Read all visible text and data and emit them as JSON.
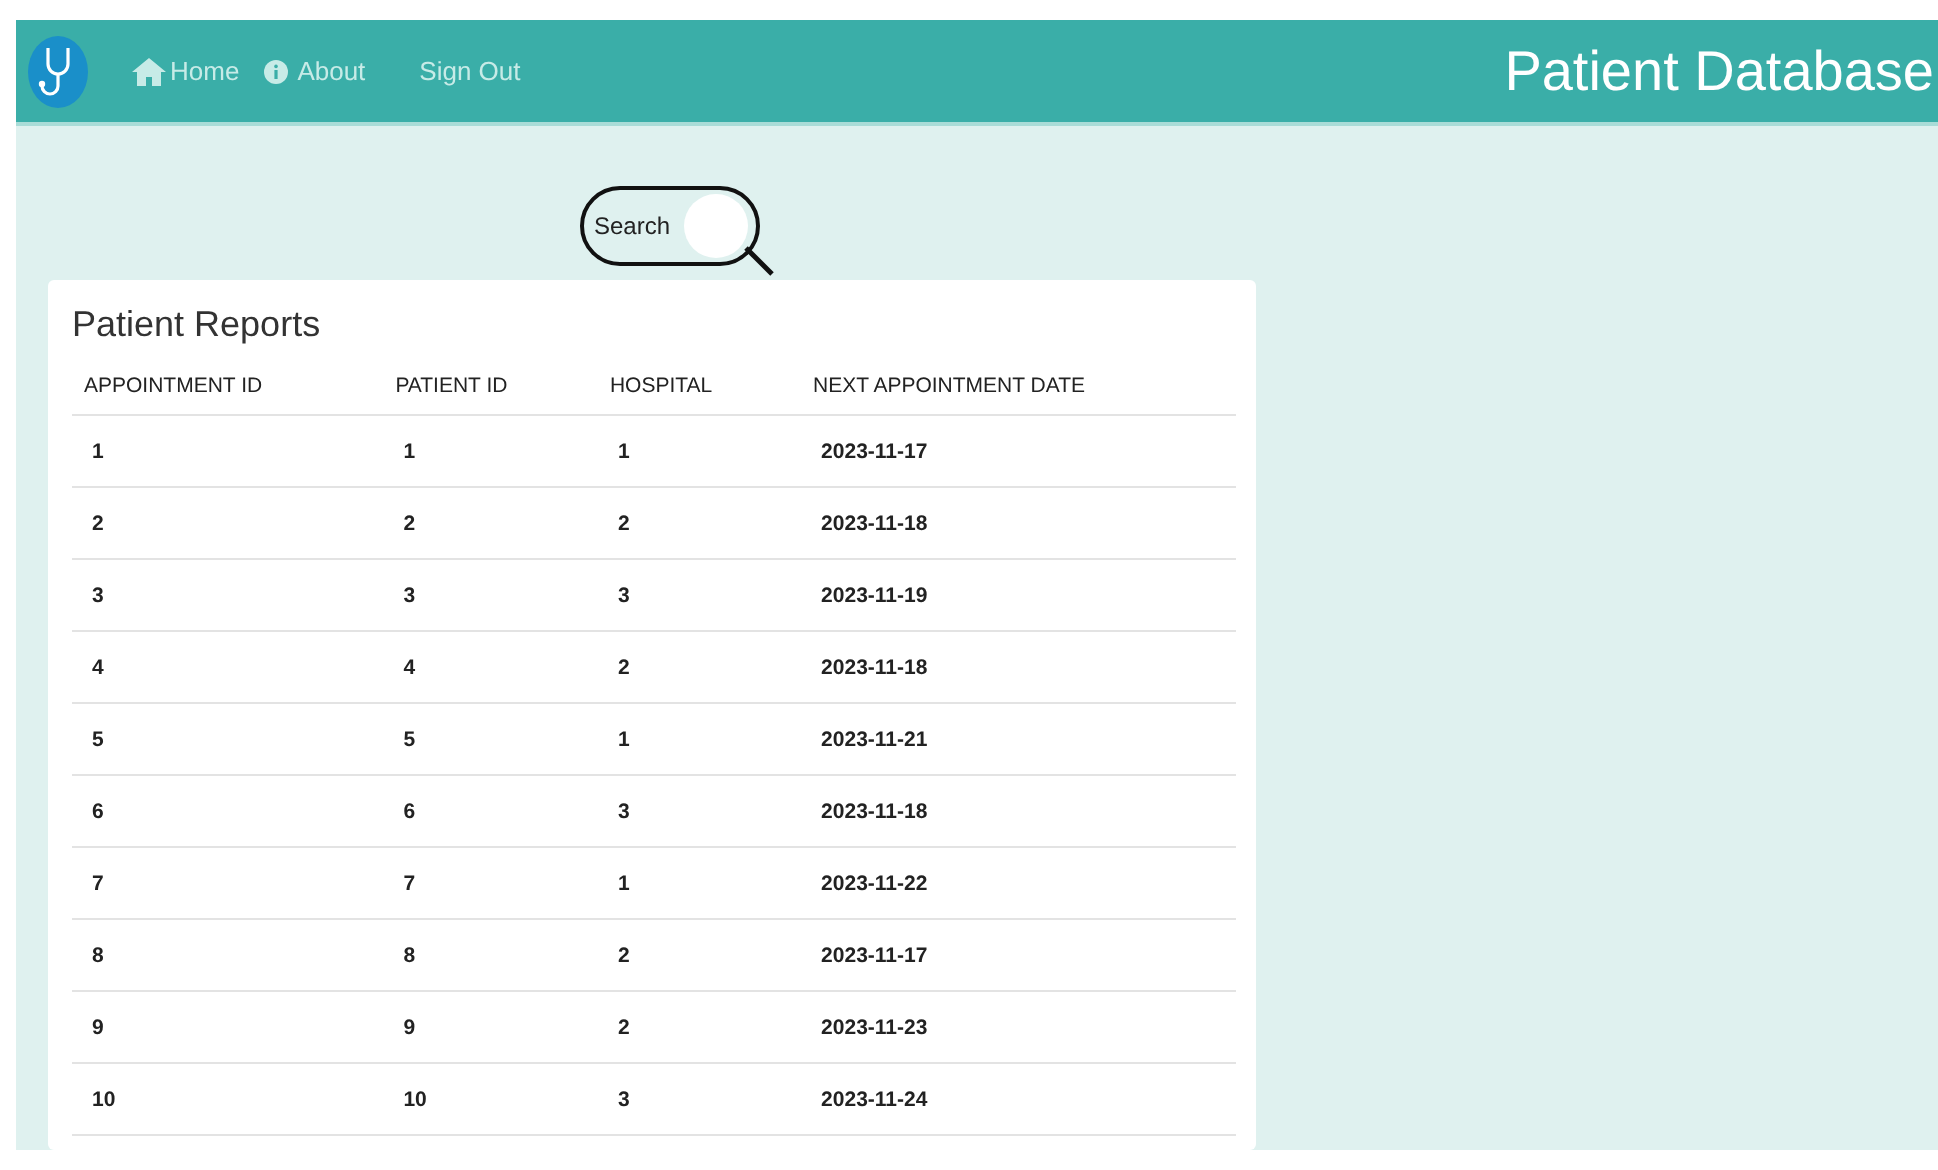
{
  "nav": {
    "links": [
      {
        "label": "Home",
        "kind": "home"
      },
      {
        "label": "About",
        "kind": "info"
      },
      {
        "label": "Sign Out",
        "kind": "plain"
      }
    ],
    "title": "Patient Database"
  },
  "search": {
    "placeholder": "Search"
  },
  "reports": {
    "title": "Patient Reports",
    "columns": [
      "APPOINTMENT ID",
      "PATIENT ID",
      "HOSPITAL",
      "NEXT APPOINTMENT DATE"
    ],
    "rows": [
      [
        "1",
        "1",
        "1",
        "2023-11-17"
      ],
      [
        "2",
        "2",
        "2",
        "2023-11-18"
      ],
      [
        "3",
        "3",
        "3",
        "2023-11-19"
      ],
      [
        "4",
        "4",
        "2",
        "2023-11-18"
      ],
      [
        "5",
        "5",
        "1",
        "2023-11-21"
      ],
      [
        "6",
        "6",
        "3",
        "2023-11-18"
      ],
      [
        "7",
        "7",
        "1",
        "2023-11-22"
      ],
      [
        "8",
        "8",
        "2",
        "2023-11-17"
      ],
      [
        "9",
        "9",
        "2",
        "2023-11-23"
      ],
      [
        "10",
        "10",
        "3",
        "2023-11-24"
      ]
    ]
  }
}
